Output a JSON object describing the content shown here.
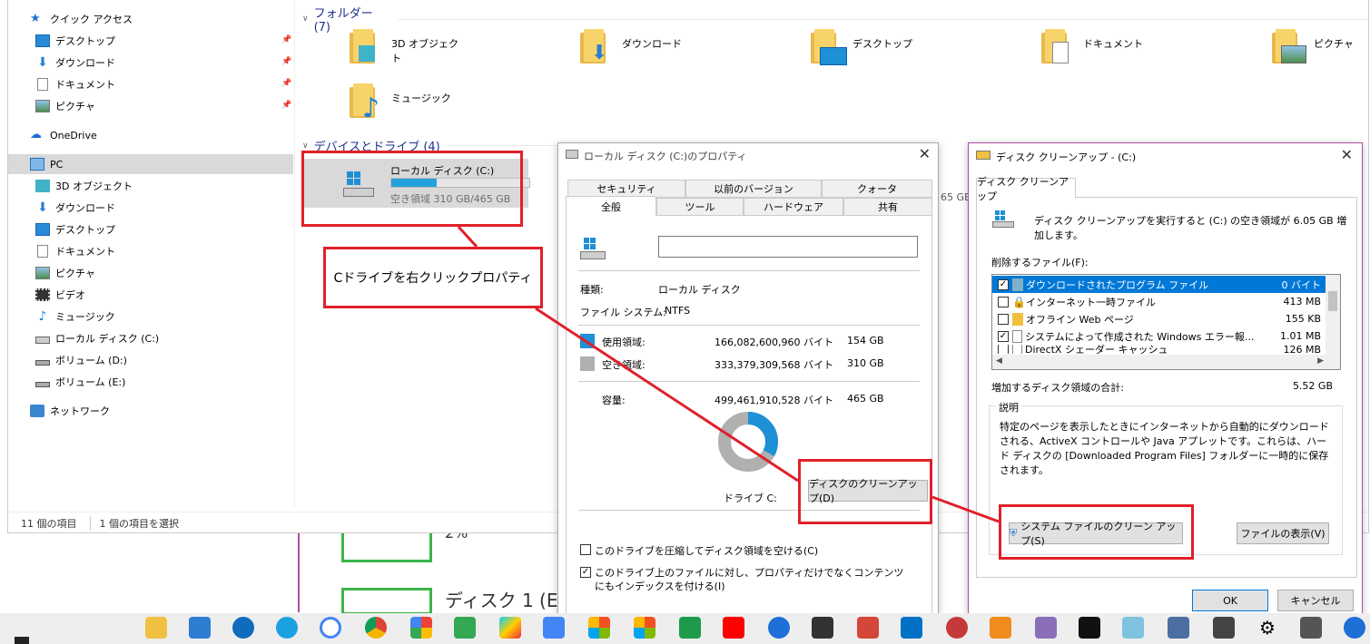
{
  "nav": {
    "quick_access": "クイック アクセス",
    "qa_items": [
      "デスクトップ",
      "ダウンロード",
      "ドキュメント",
      "ピクチャ"
    ],
    "onedrive": "OneDrive",
    "pc": "PC",
    "pc_items": [
      "3D オブジェクト",
      "ダウンロード",
      "デスクトップ",
      "ドキュメント",
      "ピクチャ",
      "ビデオ",
      "ミュージック",
      "ローカル ディスク (C:)",
      "ボリューム (D:)",
      "ボリューム (E:)"
    ],
    "network": "ネットワーク"
  },
  "status": {
    "items": "11 個の項目",
    "selected": "1 個の項目を選択"
  },
  "folders": {
    "header": "フォルダー (7)",
    "items": [
      "3D オブジェクト",
      "ダウンロード",
      "デスクトップ",
      "ドキュメント",
      "ピクチャ",
      "ミュージック"
    ]
  },
  "drives": {
    "header": "デバイスとドライブ (4)",
    "c_name": "ローカル ディスク (C:)",
    "c_free": "空き領域 310 GB/465 GB",
    "c_used_fraction": 0.33
  },
  "callout": "Cドライブを右クリックプロパティ",
  "props": {
    "title": "ローカル ディスク (C:)のプロパティ",
    "tabs_top": [
      "セキュリティ",
      "以前のバージョン",
      "クォータ"
    ],
    "tabs_bottom": [
      "全般",
      "ツール",
      "ハードウェア",
      "共有"
    ],
    "type_label": "種類:",
    "type_value": "ローカル ディスク",
    "fs_label": "ファイル システム:",
    "fs_value": "NTFS",
    "used_label": "使用領域:",
    "used_bytes": "166,082,600,960 バイト",
    "used_gb": "154 GB",
    "free_label": "空き領域:",
    "free_bytes": "333,379,309,568 バイト",
    "free_gb": "310 GB",
    "cap_label": "容量:",
    "cap_bytes": "499,461,910,528 バイト",
    "cap_gb": "465 GB",
    "drive_label": "ドライブ C:",
    "cleanup_button": "ディスクのクリーンアップ(D)",
    "compress": "このドライブを圧縮してディスク領域を空ける(C)",
    "index": "このドライブ上のファイルに対し、プロパティだけでなくコンテンツにもインデックスを付ける(I)",
    "used_color": "#1e90d6",
    "free_color": "#b0b0b0",
    "partial_number": "65 GB"
  },
  "cleanup": {
    "title": "ディスク クリーンアップ - (C:)",
    "tab": "ディスク クリーンアップ",
    "intro": "ディスク クリーンアップを実行すると (C:) の空き領域が 6.05 GB 増加します。",
    "files_label": "削除するファイル(F):",
    "files": [
      {
        "name": "ダウンロードされたプログラム ファイル",
        "size": "0 バイト",
        "checked": true
      },
      {
        "name": "インターネット一時ファイル",
        "size": "413 MB",
        "checked": false
      },
      {
        "name": "オフライン Web ページ",
        "size": "155 KB",
        "checked": false
      },
      {
        "name": "システムによって作成された Windows エラー報...",
        "size": "1.01 MB",
        "checked": true
      },
      {
        "name": "DirectX シェーダー キャッシュ",
        "size": "126 MB",
        "checked": false
      }
    ],
    "total_label": "増加するディスク領域の合計:",
    "total_value": "5.52 GB",
    "desc_label": "説明",
    "desc": "特定のページを表示したときにインターネットから自動的にダウンロードされる、ActiveX コントロールや Java アプレットです。これらは、ハード ディスクの [Downloaded Program Files] フォルダーに一時的に保存されます。",
    "sys_button": "システム ファイルのクリーン アップ(S)",
    "view_button": "ファイルの表示(V)",
    "ok": "OK",
    "cancel": "キャンセル"
  },
  "diskmgmt": {
    "percent": "2%",
    "disk": "ディスク 1 (E"
  }
}
